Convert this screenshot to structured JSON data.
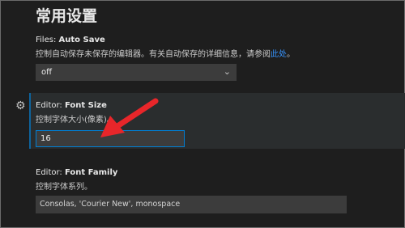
{
  "page_title": "常用设置",
  "settings": [
    {
      "category": "Files: ",
      "key": "Auto Save",
      "description": "控制自动保存未保存的编辑器。有关自动保存的详细信息，请参阅",
      "link_text": "此处",
      "description_end": "。",
      "value": "off"
    },
    {
      "category": "Editor: ",
      "key": "Font Size",
      "description": "控制字体大小(像素)。",
      "value": "16"
    },
    {
      "category": "Editor: ",
      "key": "Font Family",
      "description": "控制字体系列。",
      "value": "Consolas, 'Courier New', monospace"
    }
  ],
  "icons": {
    "gear": "gear-icon",
    "dropdown": "chevron-down-icon",
    "annotation": "red-arrow"
  },
  "colors": {
    "accent": "#007fd4",
    "annotation": "#e8262a",
    "link": "#3794ff"
  }
}
